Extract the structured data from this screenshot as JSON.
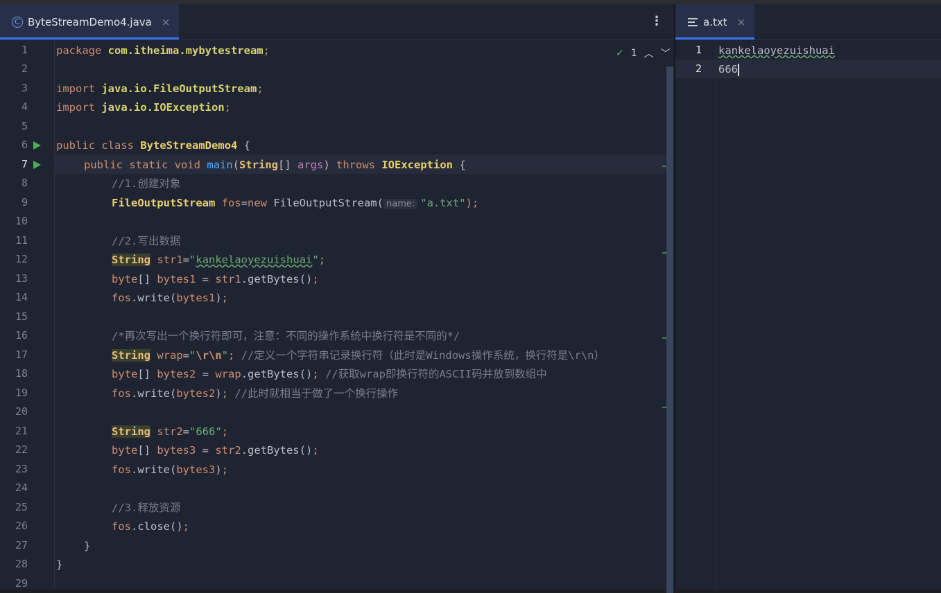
{
  "left_tab": {
    "title": "ByteStreamDemo4.java",
    "close": "×",
    "icon_letter": "C"
  },
  "right_tab": {
    "title": "a.txt",
    "close": "×"
  },
  "menu": "⋮",
  "inspection": {
    "count": "1"
  },
  "line_numbers": [
    "1",
    "2",
    "3",
    "4",
    "5",
    "6",
    "7",
    "8",
    "9",
    "10",
    "11",
    "12",
    "13",
    "14",
    "15",
    "16",
    "17",
    "18",
    "19",
    "20",
    "21",
    "22",
    "23",
    "24",
    "25",
    "26",
    "27",
    "28",
    "29"
  ],
  "code": {
    "l1a": "package",
    "l1b": "com.itheima.mybytestream",
    "l1c": ";",
    "l3a": "import",
    "l3b": "java.io.FileOutputStream",
    "l3c": ";",
    "l4a": "import",
    "l4b": "java.io.IOException",
    "l4c": ";",
    "l6a": "public class",
    "l6b": "ByteStreamDemo4",
    "l6c": " {",
    "l7a": "public static void",
    "l7b": "main",
    "l7c": "(",
    "l7d": "String",
    "l7e": "[] ",
    "l7f": "args",
    "l7g": ") ",
    "l7h": "throws",
    "l7i": "IOException",
    "l7j": " {",
    "l8": "//1.创建对象",
    "l9a": "FileOutputStream",
    "l9b": "fos",
    "l9c": "=",
    "l9d": "new",
    "l9e": " FileOutputStream(",
    "l9hint": "name:",
    "l9f": "\"a.txt\"",
    "l9g": ");",
    "l11": "//2.写出数据",
    "l12a": "String",
    "l12b": "str1",
    "l12c": "=",
    "l12d": "\"",
    "l12e": "kankelaoyezuishuai",
    "l12f": "\"",
    "l12g": ";",
    "l13a": "byte",
    "l13b": "[] ",
    "l13c": "bytes1",
    "l13d": " = ",
    "l13e": "str1",
    "l13f": ".getBytes()",
    "l13g": ";",
    "l14a": "fos",
    "l14b": ".write(",
    "l14c": "bytes1",
    "l14d": ")",
    "l14e": ";",
    "l16": "/*再次写出一个换行符即可，注意：不同的操作系统中换行符是不同的*/",
    "l17a": "String",
    "l17b": "wrap",
    "l17c": "=",
    "l17d": "\"",
    "l17e": "\\r\\n",
    "l17f": "\"",
    "l17g": "; ",
    "l17h": "//定义一个字符串记录换行符（此时是Windows操作系统，换行符是\\r\\n）",
    "l18a": "byte",
    "l18b": "[] ",
    "l18c": "bytes2",
    "l18d": " = ",
    "l18e": "wrap",
    "l18f": ".getBytes()",
    "l18g": "; ",
    "l18h": "//获取wrap即换行符的ASCII码并放到数组中",
    "l19a": "fos",
    "l19b": ".write(",
    "l19c": "bytes2",
    "l19d": ")",
    "l19e": "; ",
    "l19f": "//此时就相当于做了一个换行操作",
    "l21a": "String",
    "l21b": "str2",
    "l21c": "=",
    "l21d": "\"666\"",
    "l21e": ";",
    "l22a": "byte",
    "l22b": "[] ",
    "l22c": "bytes3",
    "l22d": " = ",
    "l22e": "str2",
    "l22f": ".getBytes()",
    "l22g": ";",
    "l23a": "fos",
    "l23b": ".write(",
    "l23c": "bytes3",
    "l23d": ")",
    "l23e": ";",
    "l25": "//3.释放资源",
    "l26a": "fos",
    "l26b": ".close()",
    "l26c": ";",
    "l27": "}",
    "l28": "}"
  },
  "right_lines": [
    "1",
    "2"
  ],
  "right_text": {
    "l1": "kankelaoyezuishuai",
    "l2": "666"
  }
}
